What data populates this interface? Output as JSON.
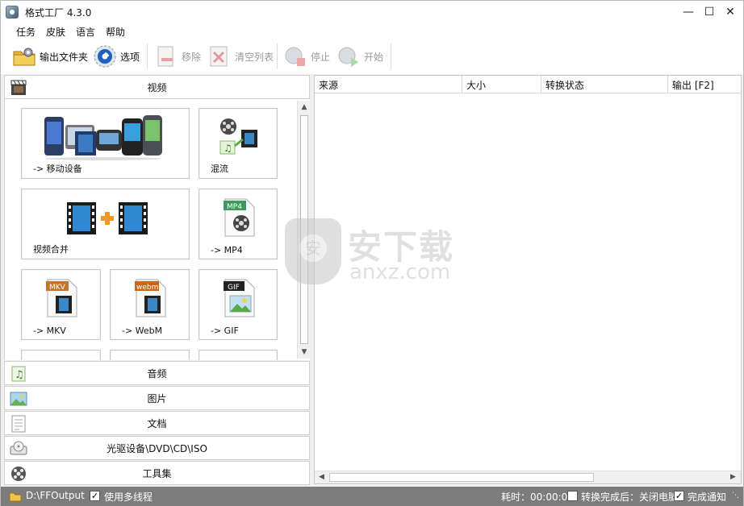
{
  "window": {
    "title": "格式工厂 4.3.0"
  },
  "menu": [
    "任务",
    "皮肤",
    "语言",
    "帮助"
  ],
  "toolbar": {
    "output_folder": "输出文件夹",
    "options": "选项",
    "remove": "移除",
    "clear_list": "清空列表",
    "stop": "停止",
    "start": "开始"
  },
  "categories": {
    "video": "视频",
    "audio": "音频",
    "image": "图片",
    "document": "文档",
    "disc": "光驱设备\\DVD\\CD\\ISO",
    "tools": "工具集"
  },
  "video_tiles": [
    {
      "label": "-> 移动设备"
    },
    {
      "label": "混流"
    },
    {
      "label": "视频合并"
    },
    {
      "label": "-> MP4"
    },
    {
      "label": "-> MKV"
    },
    {
      "label": "-> WebM"
    },
    {
      "label": "-> GIF"
    }
  ],
  "tile_badges": {
    "mp4": "MP4",
    "mkv": "MKV",
    "webm": "webm",
    "gif": "GIF"
  },
  "columns": [
    "来源",
    "大小",
    "转换状态",
    "输出 [F2]"
  ],
  "watermark": {
    "line1": "安下载",
    "line2": "anxz.com"
  },
  "status": {
    "output_path": "D:\\FFOutput",
    "multithread": "使用多线程",
    "multithread_checked": true,
    "elapsed": "耗时：00:00:00",
    "shutdown_after": "转换完成后：关闭电脑",
    "shutdown_checked": false,
    "notify": "完成通知",
    "notify_checked": true
  },
  "colors": {
    "accent": "#2a6fd6",
    "status_bg": "#7c7c7c"
  }
}
